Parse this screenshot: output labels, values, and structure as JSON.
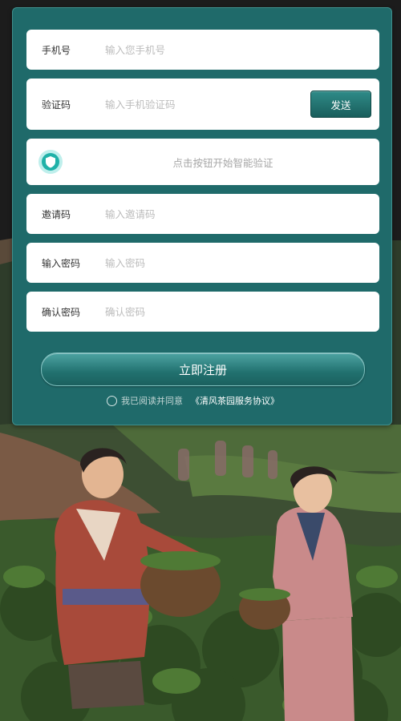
{
  "form": {
    "phone": {
      "label": "手机号",
      "placeholder": "输入您手机号"
    },
    "code": {
      "label": "验证码",
      "placeholder": "输入手机验证码",
      "send_label": "发送"
    },
    "captcha": {
      "text": "点击按钮开始智能验证"
    },
    "invite": {
      "label": "邀请码",
      "placeholder": "输入邀请码"
    },
    "password": {
      "label": "输入密码",
      "placeholder": "输入密码"
    },
    "confirm": {
      "label": "确认密码",
      "placeholder": "确认密码"
    },
    "register_label": "立即注册",
    "agreement": {
      "text": "我已阅读并同意",
      "link": "《清风茶园服务协议》"
    }
  },
  "colors": {
    "panel": "#1f6a6a",
    "button": "#21716f",
    "field_bg": "#ffffff",
    "placeholder": "#bcbcbc"
  },
  "icons": {
    "captcha": "shield-check-icon",
    "agreement": "radio-unchecked-icon"
  }
}
